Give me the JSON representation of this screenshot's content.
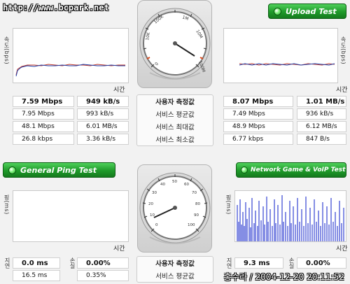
{
  "watermark": "http://www.bcpark.net",
  "header": {
    "upload_test": "Upload Test",
    "general_ping_test": "General Ping Test",
    "network_game_test": "Network Game & VoIP Test"
  },
  "axes": {
    "speed_axis": "속도(bps)",
    "time_label": "시간",
    "ping_axis": "핑(ms)"
  },
  "labels": {
    "user_measured": "사용자 측정값",
    "service_avg": "서비스 평균값",
    "service_max": "서비스 최대값",
    "service_min": "서비스 최소값"
  },
  "download": {
    "rows": [
      {
        "a": "7.59 Mbps",
        "b": "949 kB/s"
      },
      {
        "a": "7.95 Mbps",
        "b": "993 kB/s"
      },
      {
        "a": "48.1 Mbps",
        "b": "6.01 MB/s"
      },
      {
        "a": "26.8 kbps",
        "b": "3.36 kB/s"
      }
    ]
  },
  "upload": {
    "rows": [
      {
        "a": "8.07 Mbps",
        "b": "1.01 MB/s"
      },
      {
        "a": "7.49 Mbps",
        "b": "936 kB/s"
      },
      {
        "a": "48.9 Mbps",
        "b": "6.12 MB/s"
      },
      {
        "a": "6.77 kbps",
        "b": "847 B/s"
      }
    ]
  },
  "ping": {
    "side_labels": [
      "지연",
      "손실"
    ],
    "rows": [
      {
        "a": "0.0 ms",
        "b": "0.00%"
      },
      {
        "a": "16.5 ms",
        "b": "0.35%"
      }
    ]
  },
  "game": {
    "side_labels": [
      "지연",
      "손실"
    ],
    "rows": [
      {
        "a": "9.3 ms",
        "b": "0.00%"
      }
    ]
  },
  "speed_gauge": {
    "ticks": [
      "0",
      "10K",
      "100K",
      "1M",
      "10M",
      "100M"
    ],
    "reading_label": "10M"
  },
  "ping_gauge": {
    "ticks": [
      "0",
      "10",
      "20",
      "30",
      "40",
      "50",
      "60",
      "70",
      "80",
      "90",
      "100"
    ]
  },
  "footer": {
    "timestamp": "홍수라 / 2004-12-20 20:11:52"
  },
  "colors": {
    "accent_green": "#1f9a2a",
    "graph_line_red": "#c0392b",
    "graph_line_blue": "#1f3ea8",
    "game_bar_blue": "#0b1ec9"
  }
}
